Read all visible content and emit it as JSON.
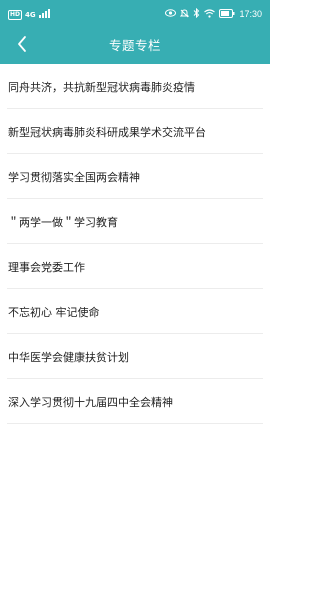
{
  "status_bar": {
    "hd_badge": "HD",
    "network": "4G",
    "battery_level_percent": 80,
    "time": "17:30",
    "icons": [
      "signal-icon",
      "eye-icon",
      "mute-icon",
      "bluetooth-icon",
      "wifi-icon",
      "battery-icon"
    ]
  },
  "header": {
    "back_icon": "chevron-left-icon",
    "title": "专题专栏"
  },
  "topics": [
    {
      "label": "同舟共济，共抗新型冠状病毒肺炎疫情"
    },
    {
      "label": "新型冠状病毒肺炎科研成果学术交流平台"
    },
    {
      "label": "学习贯彻落实全国两会精神"
    },
    {
      "label": "＂两学一做＂学习教育"
    },
    {
      "label": "理事会党委工作"
    },
    {
      "label": "不忘初心  牢记使命"
    },
    {
      "label": "中华医学会健康扶贫计划"
    },
    {
      "label": "深入学习贯彻十九届四中全会精神"
    }
  ],
  "colors": {
    "brand": "#37aeb3",
    "divider": "#ececec",
    "text": "#222222"
  }
}
